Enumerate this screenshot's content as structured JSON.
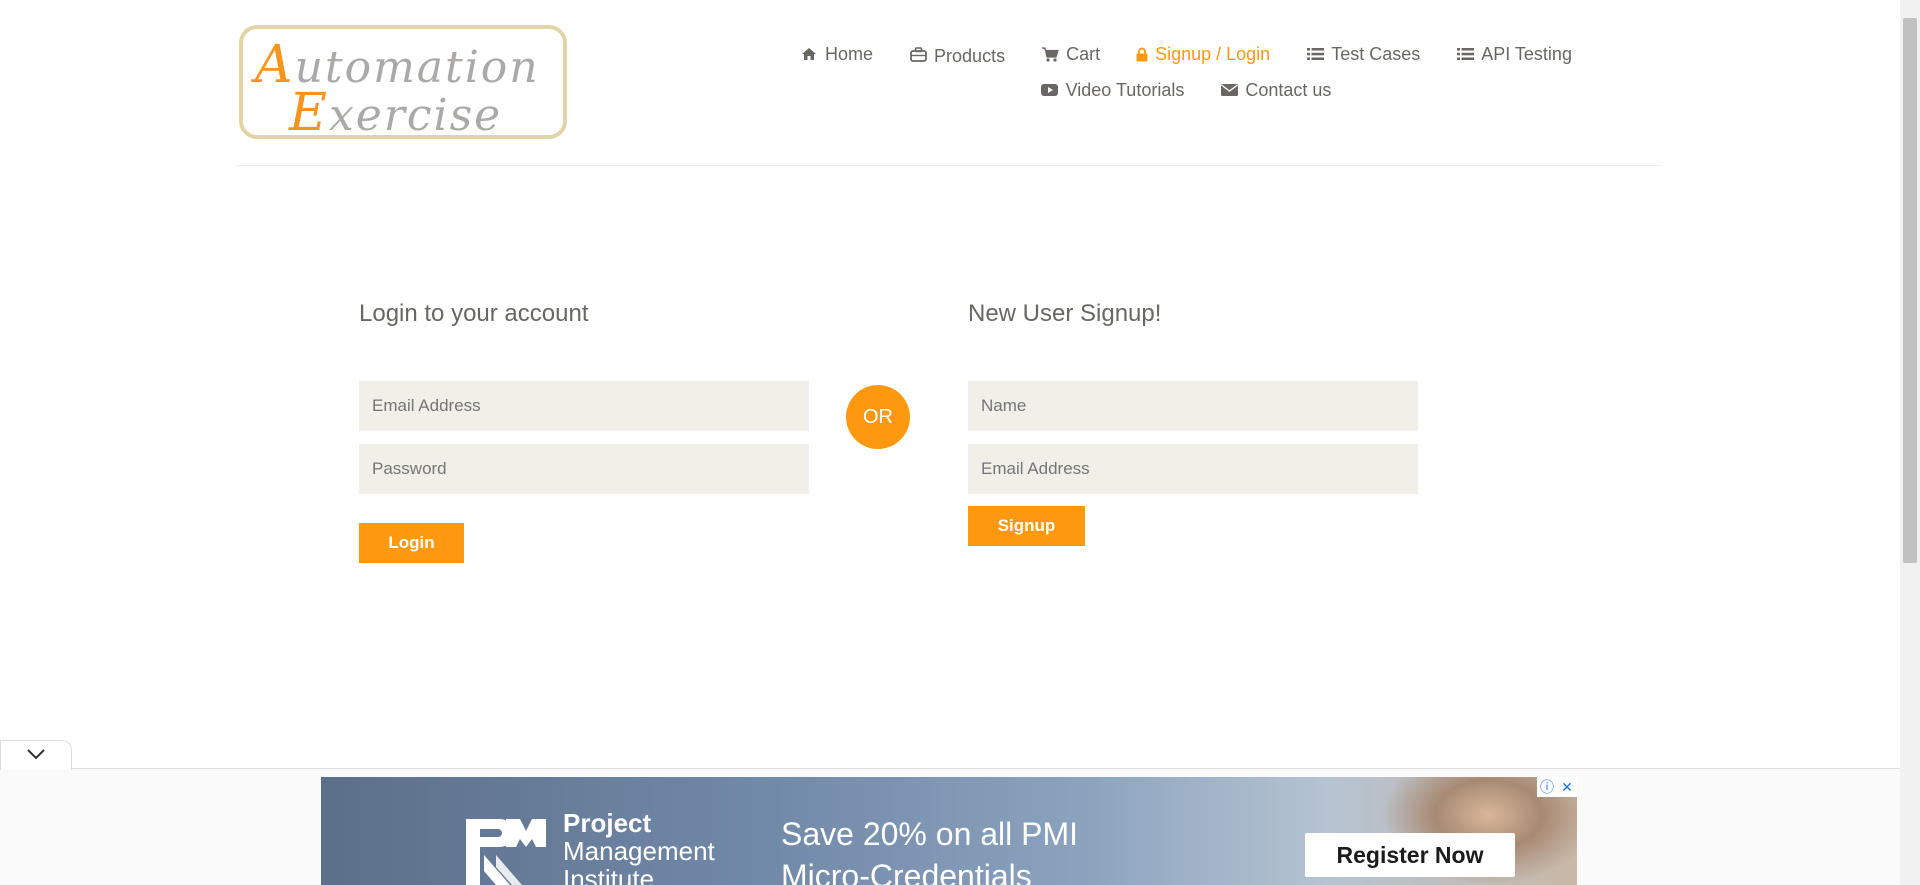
{
  "brand": {
    "logo_line1_cap": "A",
    "logo_line1_rest": "utomation",
    "logo_line2_cap": "E",
    "logo_line2_rest": "xercise"
  },
  "nav": {
    "home": "Home",
    "products": "Products",
    "cart": "Cart",
    "signup_login": "Signup / Login",
    "test_cases": "Test Cases",
    "api_testing": "API Testing",
    "video_tutorials": "Video Tutorials",
    "contact_us": "Contact us"
  },
  "login": {
    "title": "Login to your account",
    "email_placeholder": "Email Address",
    "password_placeholder": "Password",
    "button": "Login"
  },
  "or_label": "OR",
  "signup": {
    "title": "New User Signup!",
    "name_placeholder": "Name",
    "email_placeholder": "Email Address",
    "button": "Signup"
  },
  "ad": {
    "org_line1": "Project",
    "org_line2": "Management",
    "org_line3": "Institute",
    "headline_line1": "Save 20% on all PMI",
    "headline_line2": "Micro-Credentials",
    "cta": "Register Now",
    "info_glyph": "ⓘ",
    "close_glyph": "✕"
  },
  "colors": {
    "accent": "#fe980f",
    "text": "#696763",
    "field_bg": "#f0f0e9"
  },
  "icons": [
    "home-icon",
    "products-icon",
    "cart-icon",
    "lock-icon",
    "list-icon",
    "youtube-icon",
    "envelope-icon",
    "chevron-down-icon"
  ]
}
